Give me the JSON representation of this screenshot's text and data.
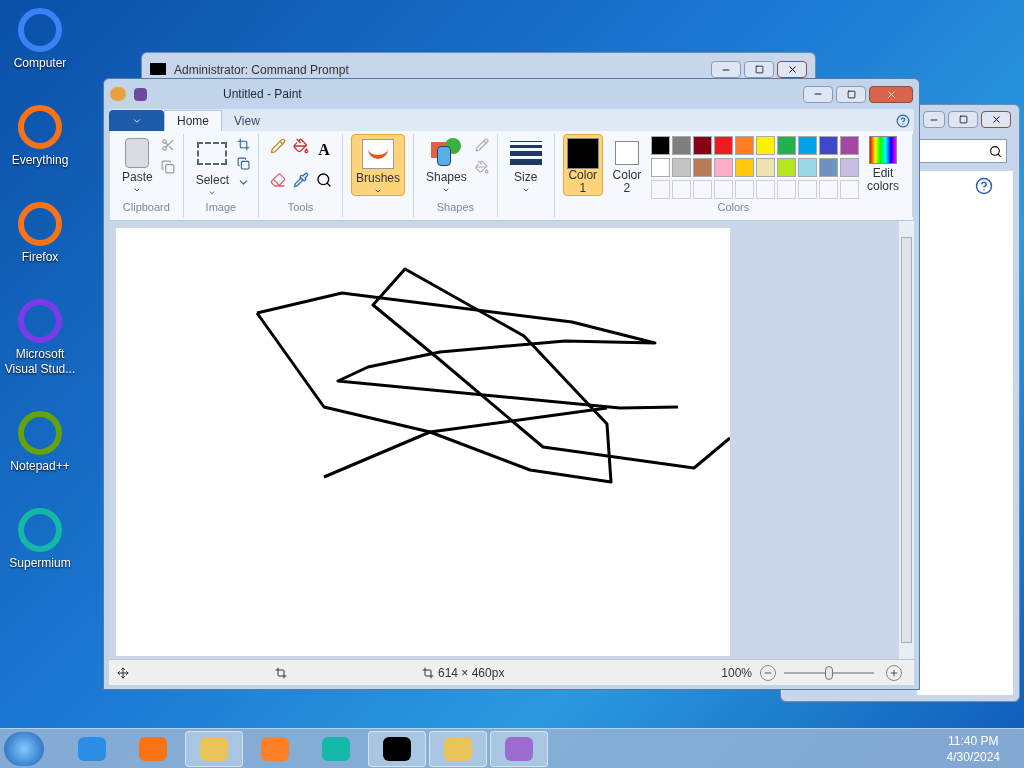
{
  "desktop_icons": [
    {
      "label": "Computer"
    },
    {
      "label": "Everything"
    },
    {
      "label": "Firefox"
    },
    {
      "label": "Microsoft Visual Stud..."
    },
    {
      "label": "Notepad++"
    },
    {
      "label": "Supermium"
    }
  ],
  "cmd_window": {
    "title": "Administrator: Command Prompt"
  },
  "paint": {
    "title": "Untitled - Paint",
    "tabs": [
      {
        "label": "Home",
        "selected": true
      },
      {
        "label": "View",
        "selected": false
      }
    ],
    "clipboard": {
      "paste": "Paste",
      "group": "Clipboard"
    },
    "image": {
      "select": "Select",
      "group": "Image"
    },
    "tools": {
      "group": "Tools",
      "text_tool": "A"
    },
    "brushes": {
      "label": "Brushes",
      "selected": true
    },
    "shapes": {
      "label": "Shapes",
      "group": "Shapes"
    },
    "size": {
      "label": "Size"
    },
    "color1": {
      "label": "Color 1",
      "selected": true,
      "color": "#000000"
    },
    "color2": {
      "label": "Color 2",
      "selected": false,
      "color": "#ffffff"
    },
    "palette": [
      {
        "color": "#000000"
      },
      {
        "color": "#7f7f7f"
      },
      {
        "color": "#880015"
      },
      {
        "color": "#ed1c24"
      },
      {
        "color": "#ff7f27"
      },
      {
        "color": "#fff200"
      },
      {
        "color": "#22b14c"
      },
      {
        "color": "#00a2e8"
      },
      {
        "color": "#3f48cc"
      },
      {
        "color": "#a349a4"
      },
      {
        "color": "#ffffff"
      },
      {
        "color": "#c3c3c3"
      },
      {
        "color": "#b97a57"
      },
      {
        "color": "#ffaec9"
      },
      {
        "color": "#ffc90e"
      },
      {
        "color": "#efe4b0"
      },
      {
        "color": "#b5e61d"
      },
      {
        "color": "#99d9ea"
      },
      {
        "color": "#7092be"
      },
      {
        "color": "#c8bfe7"
      }
    ],
    "edit_colors": "Edit colors",
    "colors_group": "Colors",
    "status": {
      "size": "614 × 460px",
      "zoom": "100%",
      "level": 0.5
    }
  },
  "taskbar": {
    "time": "11:40 PM",
    "date": "4/30/2024"
  }
}
